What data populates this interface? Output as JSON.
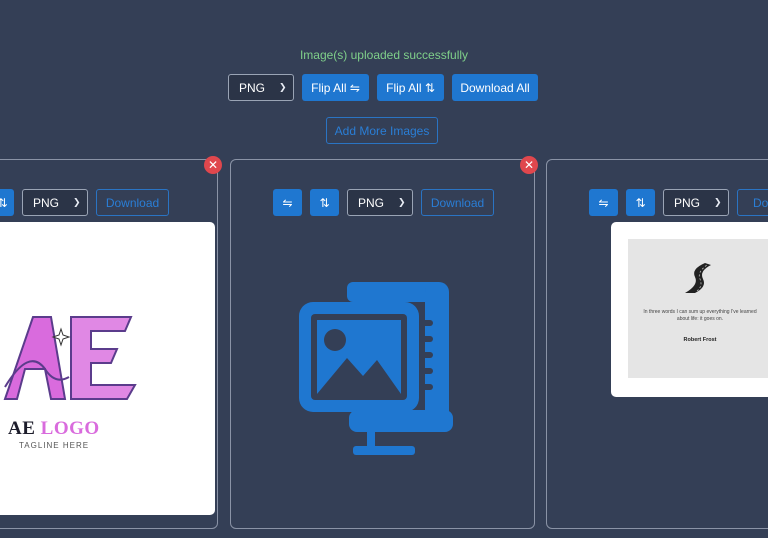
{
  "status_message": "Image(s) uploaded successfully",
  "toolbar": {
    "format_value": "PNG",
    "flip_all_horizontal": "Flip All ⇋",
    "flip_all_vertical": "Flip All ⇅",
    "download_all": "Download All"
  },
  "add_more_label": "Add More Images",
  "cards": [
    {
      "flip_v_icon": "⇅",
      "format_value": "PNG",
      "download_label": "Download",
      "preview": {
        "type": "ae-logo",
        "title_plain": "AE ",
        "title_accent": "LOGO",
        "tagline": "TAGLINE HERE"
      }
    },
    {
      "flip_h_icon": "⇋",
      "flip_v_icon": "⇅",
      "format_value": "PNG",
      "download_label": "Download",
      "close_icon": "✕",
      "preview": {
        "type": "image-placeholder-icon"
      }
    },
    {
      "flip_h_icon": "⇋",
      "flip_v_icon": "⇅",
      "format_value": "PNG",
      "download_label": "Dow",
      "preview": {
        "type": "quote-card",
        "quote": "In three words I can sum up everything I've learned about life: it goes on.",
        "author": "Robert Frost"
      }
    }
  ],
  "close_icon": "✕",
  "colors": {
    "background": "#343f56",
    "accent": "#1f77d0",
    "success": "#7fd08a",
    "danger": "#e0474d"
  }
}
